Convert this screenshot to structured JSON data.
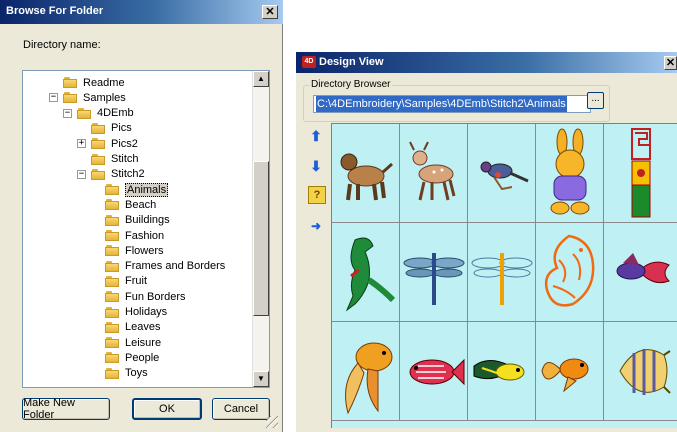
{
  "browse_dialog": {
    "title": "Browse For Folder",
    "close_glyph": "✕",
    "directory_label": "Directory name:",
    "tree": [
      {
        "label": "Readme",
        "depth": 0,
        "expander": "",
        "selected": false
      },
      {
        "label": "Samples",
        "depth": 0,
        "expander": "−",
        "selected": false
      },
      {
        "label": "4DEmb",
        "depth": 1,
        "expander": "−",
        "selected": false
      },
      {
        "label": "Pics",
        "depth": 2,
        "expander": "",
        "selected": false
      },
      {
        "label": "Pics2",
        "depth": 2,
        "expander": "+",
        "selected": false
      },
      {
        "label": "Stitch",
        "depth": 2,
        "expander": "",
        "selected": false
      },
      {
        "label": "Stitch2",
        "depth": 2,
        "expander": "−",
        "selected": false
      },
      {
        "label": "Animals",
        "depth": 3,
        "expander": "",
        "selected": true
      },
      {
        "label": "Beach",
        "depth": 3,
        "expander": "",
        "selected": false
      },
      {
        "label": "Buildings",
        "depth": 3,
        "expander": "",
        "selected": false
      },
      {
        "label": "Fashion",
        "depth": 3,
        "expander": "",
        "selected": false
      },
      {
        "label": "Flowers",
        "depth": 3,
        "expander": "",
        "selected": false
      },
      {
        "label": "Frames and Borders",
        "depth": 3,
        "expander": "",
        "selected": false
      },
      {
        "label": "Fruit",
        "depth": 3,
        "expander": "",
        "selected": false
      },
      {
        "label": "Fun Borders",
        "depth": 3,
        "expander": "",
        "selected": false
      },
      {
        "label": "Holidays",
        "depth": 3,
        "expander": "",
        "selected": false
      },
      {
        "label": "Leaves",
        "depth": 3,
        "expander": "",
        "selected": false
      },
      {
        "label": "Leisure",
        "depth": 3,
        "expander": "",
        "selected": false
      },
      {
        "label": "People",
        "depth": 3,
        "expander": "",
        "selected": false
      },
      {
        "label": "Toys",
        "depth": 3,
        "expander": "",
        "selected": false
      }
    ],
    "buttons": {
      "new_folder": "Make New Folder",
      "ok": "OK",
      "cancel": "Cancel"
    }
  },
  "design_view": {
    "title": "Design View",
    "app_icon_text": "4D",
    "close_glyph": "✕",
    "group_label": "Directory Browser",
    "path_value": "C:\\4DEmbroidery\\Samples\\4DEmb\\Stitch2\\Animals",
    "browse_button": "...",
    "toolbar": [
      {
        "name": "up-arrow-icon",
        "glyph": "⬆",
        "color": "#1f5fd6"
      },
      {
        "name": "down-arrow-icon",
        "glyph": "⬇",
        "color": "#1f5fd6"
      },
      {
        "name": "help-icon",
        "glyph": "?",
        "color": "#c8a000"
      },
      {
        "name": "open-design-icon",
        "glyph": "➜",
        "color": "#1f5fd6"
      }
    ],
    "thumbnails": [
      "dog-design",
      "fawn-design",
      "bird-design",
      "bunny-design",
      "totem-design",
      "dinosaur-design",
      "dragonfly-design",
      "dragonfly-outline-design",
      "chick-outline-design",
      "betta-fish-design",
      "goldfish-design",
      "red-fish-design",
      "fancy-fish-design",
      "goldfish-small-design",
      "angelfish-design"
    ],
    "grid_background": "#bff0f4"
  }
}
